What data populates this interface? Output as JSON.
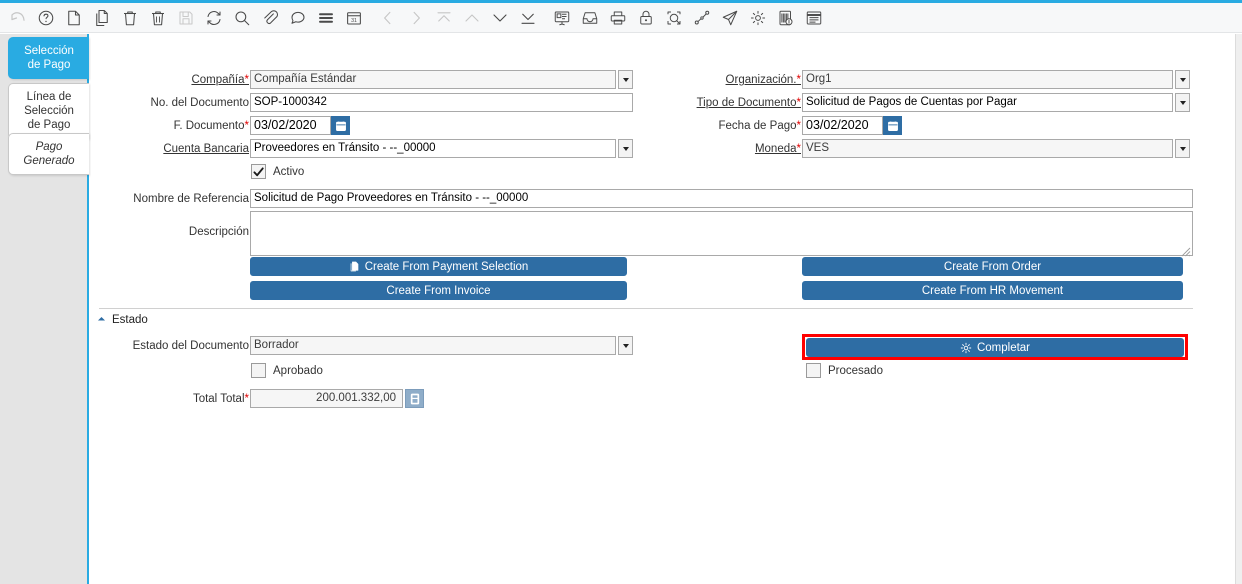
{
  "window": {
    "accent_color": "#29abe2",
    "button_color": "#2e6da4",
    "highlight_color": "#ff0000"
  },
  "toolbar": {
    "items": [
      {
        "name": "undo-icon",
        "title": "Deshacer",
        "disabled": true
      },
      {
        "name": "help-icon",
        "title": "Ayuda",
        "disabled": false
      },
      {
        "name": "new-record-icon",
        "title": "Nuevo Registro",
        "disabled": false
      },
      {
        "name": "copy-record-icon",
        "title": "Copiar Registro",
        "disabled": false
      },
      {
        "name": "delete-icon",
        "title": "Eliminar",
        "disabled": false
      },
      {
        "name": "delete-all-icon",
        "title": "Eliminar Todo",
        "disabled": false
      },
      {
        "name": "save-icon",
        "title": "Guardar",
        "disabled": true
      },
      {
        "name": "refresh-icon",
        "title": "Refrescar",
        "disabled": false
      },
      {
        "name": "search-icon",
        "title": "Buscar",
        "disabled": false
      },
      {
        "name": "attachment-icon",
        "title": "Adjunto",
        "disabled": false
      },
      {
        "name": "chat-icon",
        "title": "Nota",
        "disabled": false
      },
      {
        "name": "menu-lines-icon",
        "title": "Menú",
        "disabled": false
      },
      {
        "name": "calendar-icon",
        "title": "Calendario",
        "disabled": false
      },
      {
        "name": "nav-previous-icon",
        "title": "Anterior",
        "disabled": true
      },
      {
        "name": "nav-next-icon",
        "title": "Siguiente",
        "disabled": true
      },
      {
        "name": "nav-first-icon",
        "title": "Primero",
        "disabled": true
      },
      {
        "name": "nav-up-icon",
        "title": "Arriba",
        "disabled": true
      },
      {
        "name": "nav-down-icon",
        "title": "Abajo",
        "disabled": false
      },
      {
        "name": "nav-last-icon",
        "title": "Último",
        "disabled": false
      },
      {
        "name": "report-icon",
        "title": "Reporte",
        "disabled": false
      },
      {
        "name": "archive-icon",
        "title": "Archivo",
        "disabled": false
      },
      {
        "name": "print-icon",
        "title": "Imprimir",
        "disabled": false
      },
      {
        "name": "lock-icon",
        "title": "Bloquear",
        "disabled": false
      },
      {
        "name": "zoom-across-icon",
        "title": "Zoom",
        "disabled": false
      },
      {
        "name": "workflow-icon",
        "title": "Flujo de Trabajo",
        "disabled": false
      },
      {
        "name": "send-icon",
        "title": "Enviar",
        "disabled": false
      },
      {
        "name": "preference-gear-icon",
        "title": "Preferencias",
        "disabled": false
      },
      {
        "name": "product-info-icon",
        "title": "Información",
        "disabled": false
      },
      {
        "name": "notes-icon",
        "title": "Notas",
        "disabled": false
      }
    ]
  },
  "sidebar": {
    "tabs": [
      {
        "label": "Selección\nde Pago",
        "line1": "Selección",
        "line2": "de Pago",
        "active": true,
        "italic": false
      },
      {
        "label": "Línea de Selección de Pago",
        "line1": "Línea de",
        "line2": "Selección",
        "line3": "de Pago",
        "active": false,
        "italic": false
      },
      {
        "label": "Pago Generado",
        "line1": "Pago",
        "line2": "Generado",
        "active": false,
        "italic": true
      }
    ]
  },
  "form": {
    "compania": {
      "label": "Compañía",
      "required": true,
      "value": "Compañía Estándar"
    },
    "no_documento": {
      "label": "No. del Documento",
      "required": false,
      "value": "SOP-1000342"
    },
    "f_documento": {
      "label": "F. Documento",
      "required": true,
      "value": "03/02/2020"
    },
    "cuenta_bancaria": {
      "label": "Cuenta Bancaria",
      "required": false,
      "value": "Proveedores en Tránsito - --_00000"
    },
    "activo": {
      "label": "Activo",
      "checked": true
    },
    "nombre_referencia": {
      "label": "Nombre de Referencia",
      "required": false,
      "value": "Solicitud de Pago Proveedores en Tránsito - --_00000"
    },
    "descripcion": {
      "label": "Descripción",
      "required": false,
      "value": ""
    },
    "organizacion": {
      "label": "Organización.",
      "required": true,
      "value": "Org1"
    },
    "tipo_documento": {
      "label": "Tipo de Documento",
      "required": true,
      "value": "Solicitud de Pagos de Cuentas por Pagar"
    },
    "fecha_pago": {
      "label": "Fecha de Pago",
      "required": true,
      "value": "03/02/2020"
    },
    "moneda": {
      "label": "Moneda",
      "required": true,
      "value": "VES"
    }
  },
  "actions": {
    "create_from_payment_selection": "Create From Payment Selection",
    "create_from_invoice": "Create From Invoice",
    "create_from_order": "Create From Order",
    "create_from_hr_movement": "Create From HR Movement"
  },
  "estado": {
    "section_title": "Estado",
    "estado_documento": {
      "label": "Estado del Documento",
      "required": false,
      "value": "Borrador"
    },
    "aprobado": {
      "label": "Aprobado",
      "checked": false
    },
    "total_total": {
      "label": "Total Total",
      "required": true,
      "value": "200.001.332,00"
    },
    "completar_button": "Completar",
    "procesado": {
      "label": "Procesado",
      "checked": false
    }
  }
}
